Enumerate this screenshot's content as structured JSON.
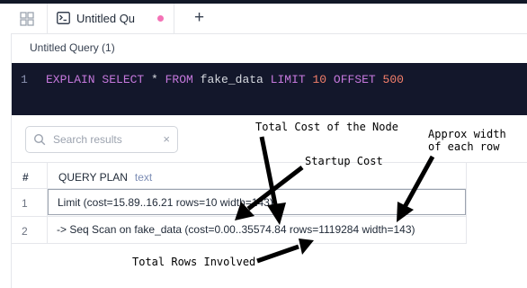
{
  "tabs": [
    {
      "label": "Untitled Qu",
      "icon": "terminal-icon",
      "unsaved": true
    }
  ],
  "tabbar": {
    "add_tab_label": "+",
    "grid_icon": "grid-icon"
  },
  "query_title": "Untitled Query (1)",
  "editor": {
    "line_number": "1",
    "tokens": [
      {
        "text": "EXPLAIN SELECT",
        "kind": "kw"
      },
      {
        "text": " * ",
        "kind": "pl"
      },
      {
        "text": "FROM",
        "kind": "kw"
      },
      {
        "text": " fake_data ",
        "kind": "pl"
      },
      {
        "text": "LIMIT",
        "kind": "kw"
      },
      {
        "text": " ",
        "kind": "pl"
      },
      {
        "text": "10",
        "kind": "nb"
      },
      {
        "text": " ",
        "kind": "pl"
      },
      {
        "text": "OFFSET",
        "kind": "kw"
      },
      {
        "text": " ",
        "kind": "pl"
      },
      {
        "text": "500",
        "kind": "nb"
      }
    ]
  },
  "search": {
    "placeholder": "Search results",
    "clear_label": "×"
  },
  "results": {
    "columns": [
      {
        "label": "#"
      },
      {
        "label": "QUERY PLAN",
        "type": "text"
      }
    ],
    "rows": [
      {
        "num": "1",
        "value": "Limit (cost=15.89..16.21 rows=10 width=143)"
      },
      {
        "num": "2",
        "value": "-> Seq Scan on fake_data (cost=0.00..35574.84 rows=1119284 width=143)"
      }
    ]
  },
  "annotations": {
    "total_cost": "Total Cost of the Node",
    "approx_width_line1": "Approx width",
    "approx_width_line2": "of each row",
    "startup_cost": "Startup Cost",
    "total_rows": "Total Rows Involved"
  },
  "colors": {
    "editor_bg": "#13172b",
    "keyword": "#c678dd",
    "number": "#f47f6b",
    "unsaved_dot": "#f472b6"
  }
}
